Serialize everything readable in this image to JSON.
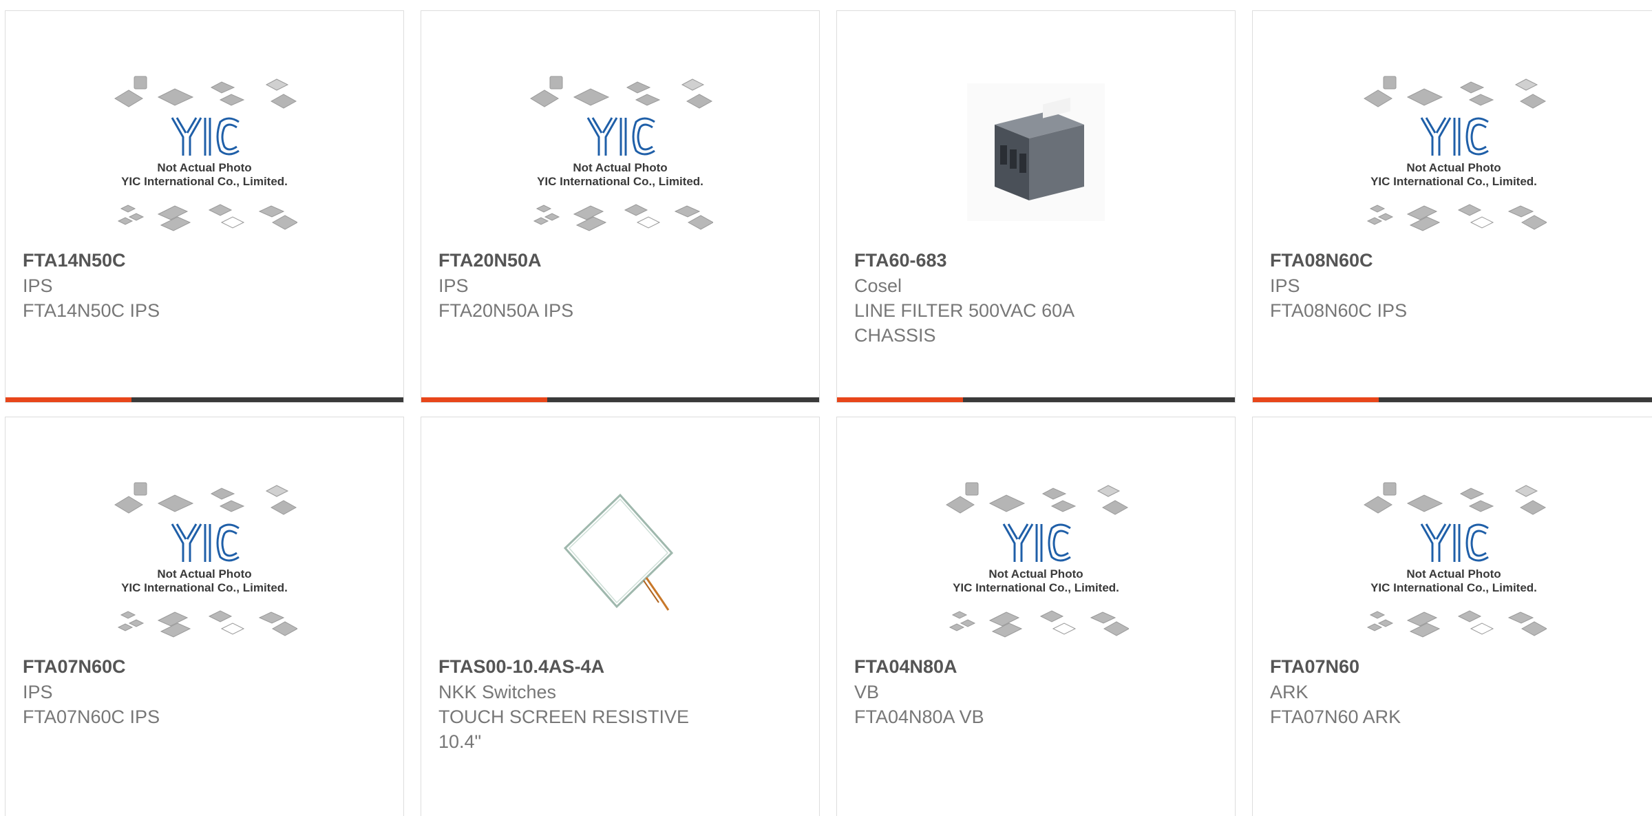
{
  "placeholder": {
    "brand_mark": "YIC",
    "line1": "Not Actual Photo",
    "line2": "YIC International Co., Limited."
  },
  "colors": {
    "accent": "#e8461a",
    "bar": "#3a3a3a",
    "logo_blue": "#1f5fa8"
  },
  "products": [
    {
      "part": "FTA14N50C",
      "brand": "IPS",
      "desc": "FTA14N50C IPS",
      "image": "placeholder"
    },
    {
      "part": "FTA20N50A",
      "brand": "IPS",
      "desc": "FTA20N50A IPS",
      "image": "placeholder"
    },
    {
      "part": "FTA60-683",
      "brand": "Cosel",
      "desc": "LINE FILTER 500VAC 60A CHASSIS",
      "image": "line-filter-photo"
    },
    {
      "part": "FTA08N60C",
      "brand": "IPS",
      "desc": "FTA08N60C IPS",
      "image": "placeholder"
    },
    {
      "part": "FTA07N60C",
      "brand": "IPS",
      "desc": "FTA07N60C IPS",
      "image": "placeholder"
    },
    {
      "part": "FTAS00-10.4AS-4A",
      "brand": "NKK Switches",
      "desc": "TOUCH SCREEN RESISTIVE 10.4\"",
      "image": "touch-screen-photo"
    },
    {
      "part": "FTA04N80A",
      "brand": "VB",
      "desc": "FTA04N80A VB",
      "image": "placeholder"
    },
    {
      "part": "FTA07N60",
      "brand": "ARK",
      "desc": "FTA07N60 ARK",
      "image": "placeholder"
    }
  ]
}
